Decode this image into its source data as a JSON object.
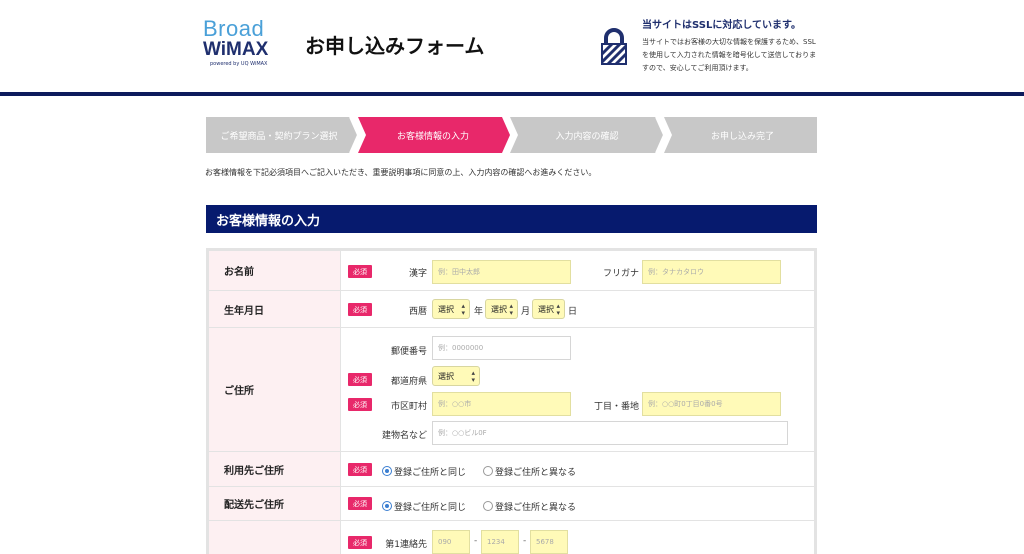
{
  "header": {
    "logo_broad": "Broad",
    "logo_wimax": "WiMAX",
    "logo_powered": "powered by UQ WiMAX",
    "form_title": "お申し込みフォーム",
    "ssl_title": "当サイトはSSLに対応しています。",
    "ssl_body": "当サイトではお客様の大切な情報を保護するため、SSLを使用して入力された情報を暗号化して送信しておりますので、安心してご利用頂けます。"
  },
  "steps": [
    {
      "label": "ご希望商品・契約プラン選択"
    },
    {
      "label": "お客様情報の入力"
    },
    {
      "label": "入力内容の確認"
    },
    {
      "label": "お申し込み完了"
    }
  ],
  "intro": "お客様情報を下記必須項目へご記入いただき、重要説明事項に同意の上、入力内容の確認へお進みください。",
  "section_title": "お客様情報の入力",
  "required_badge": "必須",
  "form": {
    "name": {
      "label": "お名前",
      "kanji_label": "漢字",
      "kanji_placeholder": "例：田中太郎",
      "kana_label": "フリガナ",
      "kana_placeholder": "例：タナカタロウ"
    },
    "birth": {
      "label": "生年月日",
      "era_label": "西暦",
      "year_value": "選択",
      "year_unit": "年",
      "month_value": "選択",
      "month_unit": "月",
      "day_value": "選択",
      "day_unit": "日"
    },
    "address": {
      "label": "ご住所",
      "zip_label": "郵便番号",
      "zip_placeholder": "例：0000000",
      "pref_label": "都道府県",
      "pref_value": "選択",
      "city_label": "市区町村",
      "city_placeholder": "例：○○市",
      "block_label": "丁目・番地",
      "block_placeholder": "例：○○町0丁目0番0号",
      "building_label": "建物名など",
      "building_placeholder": "例：○○ビル0F"
    },
    "usage_address": {
      "label": "利用先ご住所",
      "option_same": "登録ご住所と同じ",
      "option_diff": "登録ご住所と異なる"
    },
    "delivery_address": {
      "label": "配送先ご住所",
      "option_same": "登録ご住所と同じ",
      "option_diff": "登録ご住所と異なる"
    },
    "phone": {
      "label": "第1連絡先",
      "part1_placeholder": "090",
      "part2_placeholder": "1234",
      "part3_placeholder": "5678",
      "separator": "-"
    }
  },
  "colors": {
    "navy": "#061a6e",
    "pink": "#e8286a",
    "input_yellow": "#fffab8",
    "label_bg": "#fdf0f2"
  }
}
